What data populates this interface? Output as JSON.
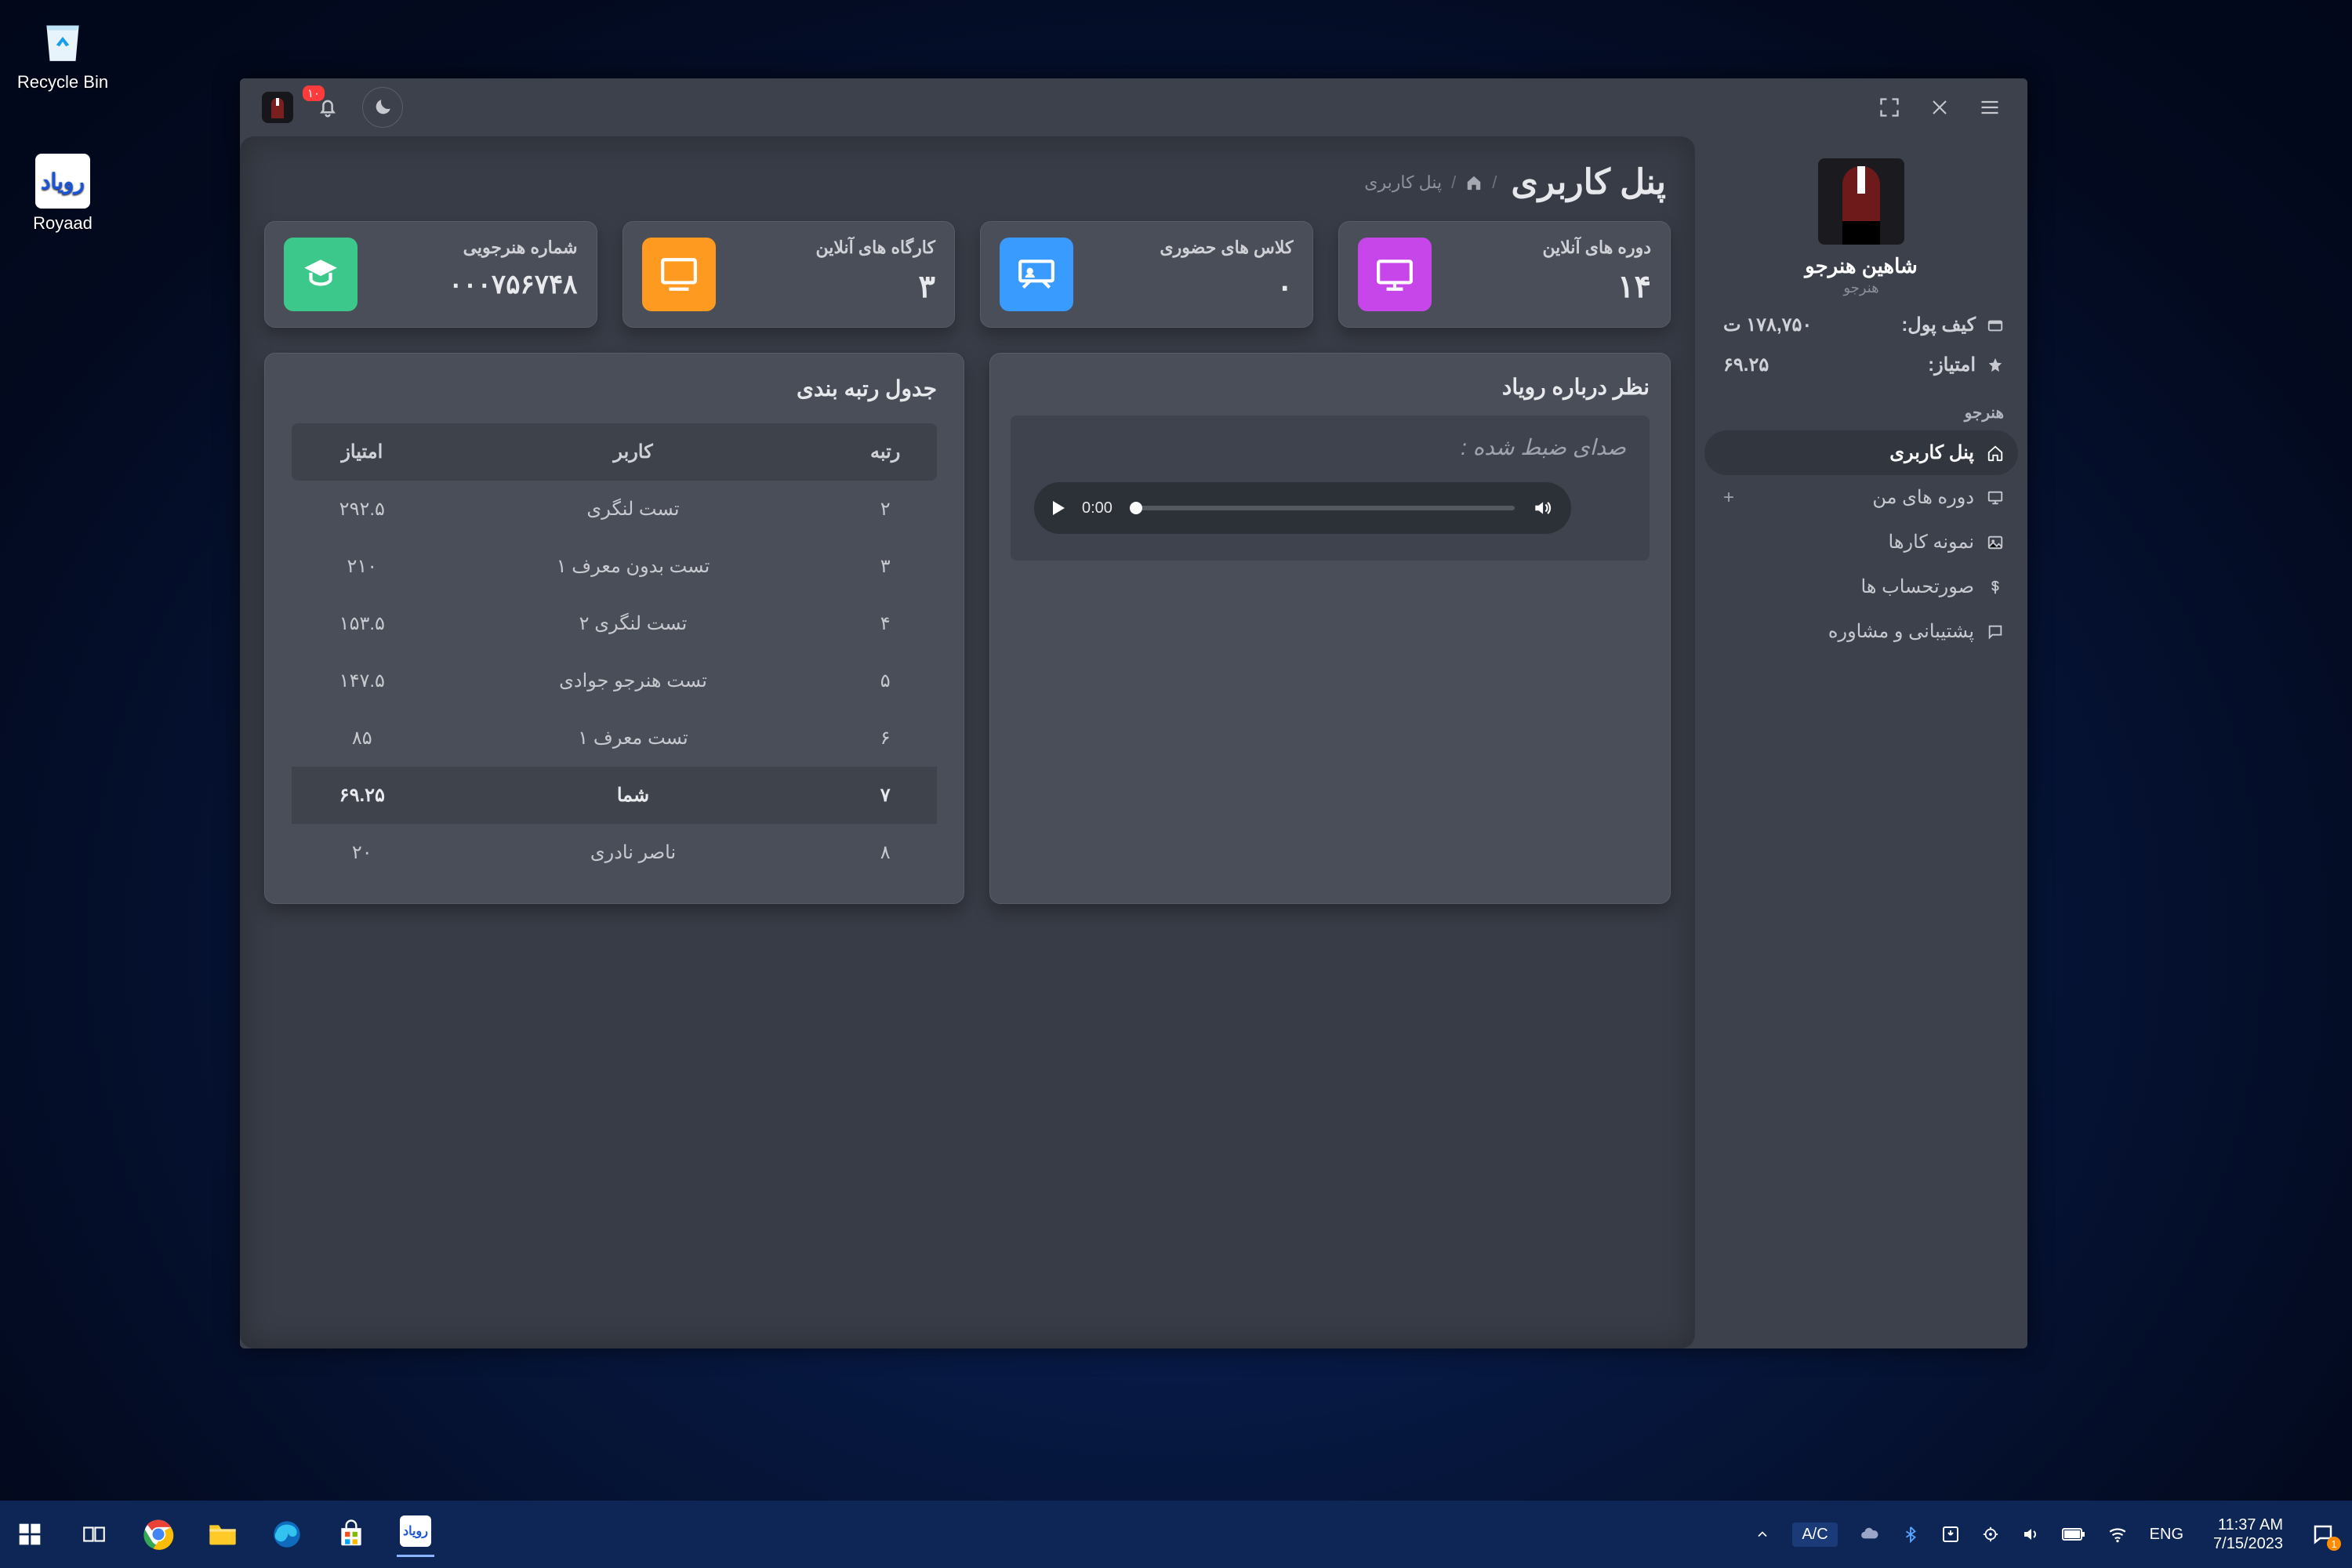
{
  "desktop": {
    "icons": [
      {
        "name": "recycle-bin",
        "label": "Recycle Bin"
      },
      {
        "name": "royaad",
        "label": "Royaad"
      }
    ]
  },
  "window": {
    "titlebar": {
      "notif_badge": "۱۰"
    },
    "user": {
      "name": "شاهین هنرجو",
      "role": "هنرجو"
    },
    "stats": {
      "wallet_label": "کیف پول:",
      "wallet_value": "۱۷۸,۷۵۰ ت",
      "points_label": "امتیاز:",
      "points_value": "۶۹.۲۵"
    },
    "sidebar": {
      "section_title": "هنرجو",
      "items": [
        {
          "label": "پنل کاربری",
          "icon": "home"
        },
        {
          "label": "دوره های من",
          "icon": "monitor",
          "plus": "+"
        },
        {
          "label": "نمونه کارها",
          "icon": "image"
        },
        {
          "label": "صورتحساب ها",
          "icon": "dollar"
        },
        {
          "label": "پشتیبانی و مشاوره",
          "icon": "chat"
        }
      ]
    },
    "page": {
      "title": "پنل کاربری",
      "breadcrumb": "پنل کاربری"
    },
    "cards": [
      {
        "label": "دوره های آنلاین",
        "value": "۱۴",
        "icon": "screen",
        "color": "purple"
      },
      {
        "label": "کلاس های حضوری",
        "value": "۰",
        "icon": "board",
        "color": "blue"
      },
      {
        "label": "کارگاه های آنلاین",
        "value": "۳",
        "icon": "desktop",
        "color": "orange"
      },
      {
        "label": "شماره هنرجویی",
        "value": "۰۰۰۷۵۶۷۴۸",
        "icon": "grad",
        "color": "teal"
      }
    ],
    "feedback": {
      "title": "نظر درباره رویاد",
      "caption": "صدای ضبط شده :",
      "time": "0:00"
    },
    "ranking": {
      "title": "جدول رتبه بندی",
      "columns": {
        "rank": "رتبه",
        "user": "کاربر",
        "points": "امتیاز"
      },
      "rows": [
        {
          "rank": "۲",
          "user": "تست لنگری",
          "points": "۲۹۲.۵"
        },
        {
          "rank": "۳",
          "user": "تست بدون معرف ۱",
          "points": "۲۱۰"
        },
        {
          "rank": "۴",
          "user": "تست لنگری ۲",
          "points": "۱۵۳.۵"
        },
        {
          "rank": "۵",
          "user": "تست هنرجو جوادی",
          "points": "۱۴۷.۵"
        },
        {
          "rank": "۶",
          "user": "تست معرف ۱",
          "points": "۸۵"
        },
        {
          "rank": "۷",
          "user": "شما",
          "points": "۶۹.۲۵",
          "highlight": true
        },
        {
          "rank": "۸",
          "user": "ناصر نادری",
          "points": "۲۰"
        }
      ]
    }
  },
  "taskbar": {
    "ac": "A/C",
    "lang": "ENG",
    "time": "11:37 AM",
    "date": "7/15/2023",
    "notif_count": "1"
  }
}
